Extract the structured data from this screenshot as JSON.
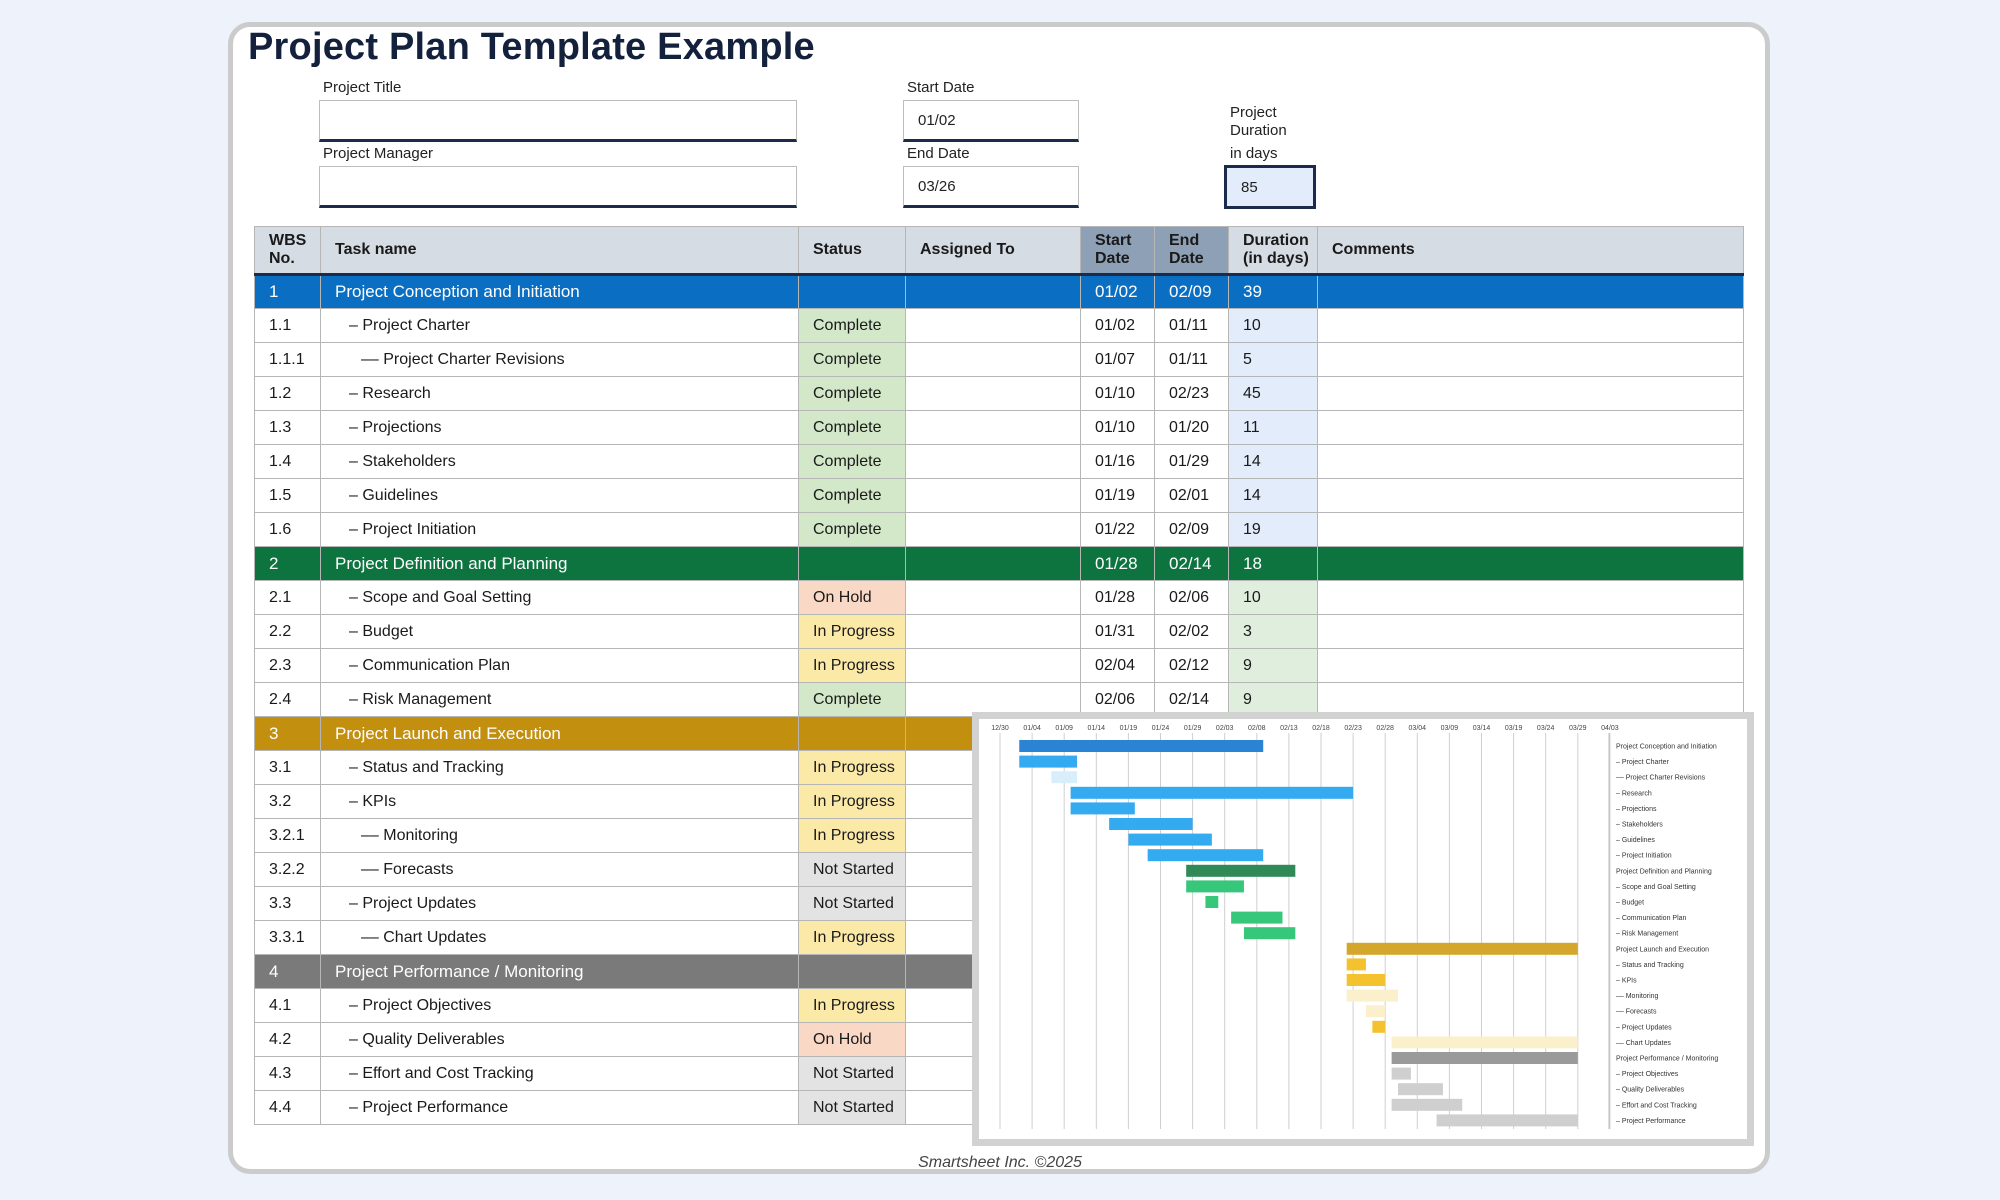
{
  "title": "Project Plan Template Example",
  "fields": {
    "project_title_label": "Project Title",
    "project_title_value": "",
    "project_manager_label": "Project Manager",
    "project_manager_value": "",
    "start_date_label": "Start Date",
    "start_date_value": "01/02",
    "end_date_label": "End Date",
    "end_date_value": "03/26",
    "duration_label_1": "Project",
    "duration_label_2": "Duration",
    "duration_label_3": "in days",
    "duration_value": "85"
  },
  "columns": {
    "wbs": "WBS No.",
    "task": "Task name",
    "status": "Status",
    "assigned": "Assigned To",
    "start": "Start Date",
    "end": "End Date",
    "duration": "Duration (in days)",
    "comments": "Comments"
  },
  "rows": [
    {
      "wbs": "1",
      "task": "Project Conception and Initiation",
      "status": "",
      "start": "01/02",
      "end": "02/09",
      "duration": "39",
      "phase": 1
    },
    {
      "wbs": "1.1",
      "task": "– Project Charter",
      "status": "Complete",
      "start": "01/02",
      "end": "01/11",
      "duration": "10"
    },
    {
      "wbs": "1.1.1",
      "task": "–– Project Charter Revisions",
      "status": "Complete",
      "start": "01/07",
      "end": "01/11",
      "duration": "5",
      "indent": 2
    },
    {
      "wbs": "1.2",
      "task": "– Research",
      "status": "Complete",
      "start": "01/10",
      "end": "02/23",
      "duration": "45"
    },
    {
      "wbs": "1.3",
      "task": "– Projections",
      "status": "Complete",
      "start": "01/10",
      "end": "01/20",
      "duration": "11"
    },
    {
      "wbs": "1.4",
      "task": "– Stakeholders",
      "status": "Complete",
      "start": "01/16",
      "end": "01/29",
      "duration": "14"
    },
    {
      "wbs": "1.5",
      "task": "– Guidelines",
      "status": "Complete",
      "start": "01/19",
      "end": "02/01",
      "duration": "14"
    },
    {
      "wbs": "1.6",
      "task": "– Project Initiation",
      "status": "Complete",
      "start": "01/22",
      "end": "02/09",
      "duration": "19"
    },
    {
      "wbs": "2",
      "task": "Project Definition and Planning",
      "status": "",
      "start": "01/28",
      "end": "02/14",
      "duration": "18",
      "phase": 2
    },
    {
      "wbs": "2.1",
      "task": "– Scope and Goal Setting",
      "status": "On Hold",
      "start": "01/28",
      "end": "02/06",
      "duration": "10"
    },
    {
      "wbs": "2.2",
      "task": "– Budget",
      "status": "In Progress",
      "start": "01/31",
      "end": "02/02",
      "duration": "3"
    },
    {
      "wbs": "2.3",
      "task": "– Communication Plan",
      "status": "In Progress",
      "start": "02/04",
      "end": "02/12",
      "duration": "9"
    },
    {
      "wbs": "2.4",
      "task": "– Risk Management",
      "status": "Complete",
      "start": "02/06",
      "end": "02/14",
      "duration": "9"
    },
    {
      "wbs": "3",
      "task": "Project Launch and Execution",
      "status": "",
      "start": "",
      "end": "",
      "duration": "",
      "phase": 3
    },
    {
      "wbs": "3.1",
      "task": "– Status and Tracking",
      "status": "In Progress",
      "start": "",
      "end": "",
      "duration": ""
    },
    {
      "wbs": "3.2",
      "task": "– KPIs",
      "status": "In Progress",
      "start": "",
      "end": "",
      "duration": ""
    },
    {
      "wbs": "3.2.1",
      "task": "–– Monitoring",
      "status": "In Progress",
      "start": "",
      "end": "",
      "duration": "",
      "indent": 2
    },
    {
      "wbs": "3.2.2",
      "task": "–– Forecasts",
      "status": "Not Started",
      "start": "",
      "end": "",
      "duration": "",
      "indent": 2
    },
    {
      "wbs": "3.3",
      "task": "– Project Updates",
      "status": "Not Started",
      "start": "",
      "end": "",
      "duration": ""
    },
    {
      "wbs": "3.3.1",
      "task": "–– Chart Updates",
      "status": "In Progress",
      "start": "",
      "end": "",
      "duration": "",
      "indent": 2
    },
    {
      "wbs": "4",
      "task": "Project Performance / Monitoring",
      "status": "",
      "start": "",
      "end": "",
      "duration": "",
      "phase": 4
    },
    {
      "wbs": "4.1",
      "task": "– Project Objectives",
      "status": "In Progress",
      "start": "",
      "end": "",
      "duration": ""
    },
    {
      "wbs": "4.2",
      "task": "– Quality Deliverables",
      "status": "On Hold",
      "start": "",
      "end": "",
      "duration": ""
    },
    {
      "wbs": "4.3",
      "task": "– Effort and Cost Tracking",
      "status": "Not Started",
      "start": "",
      "end": "",
      "duration": ""
    },
    {
      "wbs": "4.4",
      "task": "– Project Performance",
      "status": "Not Started",
      "start": "",
      "end": "",
      "duration": ""
    }
  ],
  "status_colors": {
    "Complete": "#d3e8c9",
    "On Hold": "#f9d8c6",
    "In Progress": "#fbe9a8",
    "Not Started": "#e3e3e3"
  },
  "gantt": {
    "date_labels": [
      "12/30",
      "01/04",
      "01/09",
      "01/14",
      "01/19",
      "01/24",
      "01/29",
      "02/03",
      "02/08",
      "02/13",
      "02/18",
      "02/23",
      "02/28",
      "03/04",
      "03/09",
      "03/14",
      "03/19",
      "03/24",
      "03/29",
      "04/03"
    ],
    "bars": [
      {
        "label": "Project Conception and Initiation",
        "start": "01/02",
        "end": "02/09",
        "color": "#2b84d3"
      },
      {
        "label": "– Project Charter",
        "start": "01/02",
        "end": "01/11",
        "color": "#34aaf0"
      },
      {
        "label": "–– Project Charter Revisions",
        "start": "01/07",
        "end": "01/11",
        "color": "#d8eefb"
      },
      {
        "label": "– Research",
        "start": "01/10",
        "end": "02/23",
        "color": "#34aaf0"
      },
      {
        "label": "– Projections",
        "start": "01/10",
        "end": "01/20",
        "color": "#34aaf0"
      },
      {
        "label": "– Stakeholders",
        "start": "01/16",
        "end": "01/29",
        "color": "#34aaf0"
      },
      {
        "label": "– Guidelines",
        "start": "01/19",
        "end": "02/01",
        "color": "#34aaf0"
      },
      {
        "label": "– Project Initiation",
        "start": "01/22",
        "end": "02/09",
        "color": "#34aaf0"
      },
      {
        "label": "Project Definition and Planning",
        "start": "01/28",
        "end": "02/14",
        "color": "#2f8a57"
      },
      {
        "label": "– Scope and Goal Setting",
        "start": "01/28",
        "end": "02/06",
        "color": "#36c77b"
      },
      {
        "label": "– Budget",
        "start": "01/31",
        "end": "02/02",
        "color": "#36c77b"
      },
      {
        "label": "– Communication Plan",
        "start": "02/04",
        "end": "02/12",
        "color": "#36c77b"
      },
      {
        "label": "– Risk Management",
        "start": "02/06",
        "end": "02/14",
        "color": "#36c77b"
      },
      {
        "label": "Project Launch and Execution",
        "start": "02/22",
        "end": "03/30",
        "color": "#d4a72c"
      },
      {
        "label": "– Status and Tracking",
        "start": "02/22",
        "end": "02/25",
        "color": "#f4c22e"
      },
      {
        "label": "– KPIs",
        "start": "02/22",
        "end": "02/28",
        "color": "#f4c22e"
      },
      {
        "label": "–– Monitoring",
        "start": "02/22",
        "end": "03/02",
        "color": "#fbf0cc"
      },
      {
        "label": "–– Forecasts",
        "start": "02/25",
        "end": "02/28",
        "color": "#fbf0cc"
      },
      {
        "label": "– Project Updates",
        "start": "02/26",
        "end": "02/28",
        "color": "#f4c22e"
      },
      {
        "label": "–– Chart Updates",
        "start": "03/01",
        "end": "03/30",
        "color": "#fbf0cc"
      },
      {
        "label": "Project Performance / Monitoring",
        "start": "03/01",
        "end": "03/30",
        "color": "#9a9a9a"
      },
      {
        "label": "– Project Objectives",
        "start": "03/01",
        "end": "03/04",
        "color": "#cfcfcf"
      },
      {
        "label": "– Quality Deliverables",
        "start": "03/02",
        "end": "03/09",
        "color": "#cfcfcf"
      },
      {
        "label": "– Effort and Cost Tracking",
        "start": "03/01",
        "end": "03/12",
        "color": "#cfcfcf"
      },
      {
        "label": "– Project Performance",
        "start": "03/08",
        "end": "03/30",
        "color": "#cfcfcf"
      }
    ]
  },
  "footer": "Smartsheet Inc. ©2025"
}
